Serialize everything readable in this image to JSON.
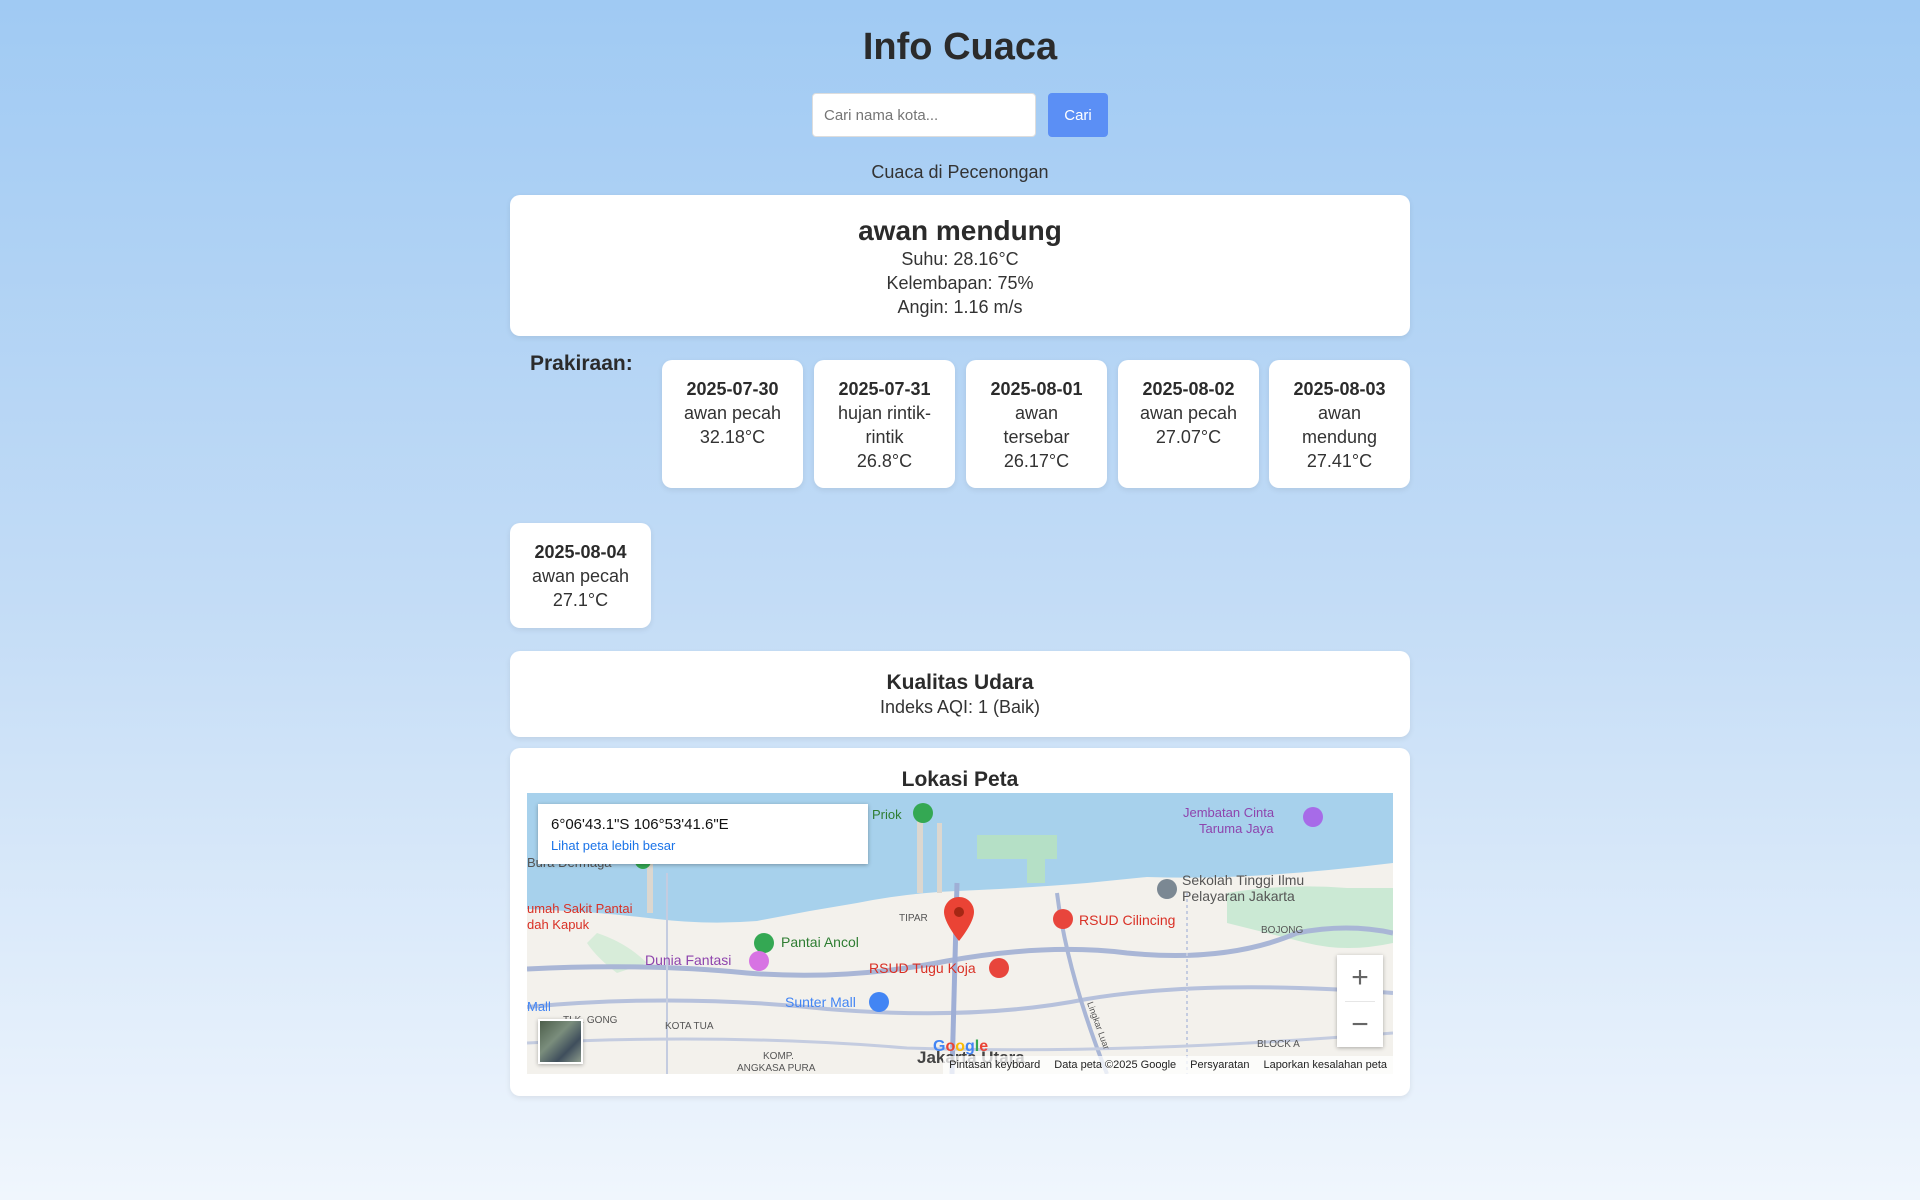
{
  "app": {
    "title": "Info Cuaca"
  },
  "search": {
    "placeholder": "Cari nama kota...",
    "value": "",
    "button_label": "Cari"
  },
  "location": {
    "label": "Cuaca di Pecenongan"
  },
  "current": {
    "description": "awan mendung",
    "temperature": "Suhu: 28.16°C",
    "humidity": "Kelembapan: 75%",
    "wind": "Angin: 1.16 m/s"
  },
  "forecast": {
    "label": "Prakiraan:",
    "days": [
      {
        "date": "2025-07-30",
        "desc": "awan pecah",
        "temp": "32.18°C"
      },
      {
        "date": "2025-07-31",
        "desc": "hujan rintik-rintik",
        "temp": "26.8°C"
      },
      {
        "date": "2025-08-01",
        "desc": "awan tersebar",
        "temp": "26.17°C"
      },
      {
        "date": "2025-08-02",
        "desc": "awan pecah",
        "temp": "27.07°C"
      },
      {
        "date": "2025-08-03",
        "desc": "awan mendung",
        "temp": "27.41°C"
      },
      {
        "date": "2025-08-04",
        "desc": "awan pecah",
        "temp": "27.1°C"
      }
    ]
  },
  "air_quality": {
    "title": "Kualitas Udara",
    "index": "Indeks AQI: 1 (Baik)"
  },
  "map": {
    "title": "Lokasi Peta",
    "coords": "6°06'43.1\"S 106°53'41.6\"E",
    "larger_map_link": "Lihat peta lebih besar",
    "zoom_in": "+",
    "zoom_out": "−",
    "google_logo": [
      "G",
      "o",
      "o",
      "g",
      "l",
      "e"
    ],
    "places": {
      "priok": "Priok",
      "jembatan": "Jembatan Cinta",
      "taruma": "Taruma Jaya",
      "bura": "Bura Dermaga",
      "sekolah1": "Sekolah Tinggi Ilmu",
      "sekolah2": "Pelayaran Jakarta",
      "rs_pantai1": "umah Sakit Pantai",
      "rs_pantai2": "dah Kapuk",
      "tipar": "TIPAR",
      "rsud_cilincing": "RSUD Cilincing",
      "bojong": "BOJONG",
      "pantai_ancol": "Pantai Ancol",
      "dunia_fantasi": "Dunia Fantasi",
      "rsud_tugu": "RSUD Tugu Koja",
      "mall": "Mall",
      "gong": "TLK. GONG",
      "kota_tua": "KOTA TUA",
      "sunter": "Sunter Mall",
      "komp1": "KOMP.",
      "komp2": "ANGKASA PURA",
      "jakarta_utara": "Jakarta Utara",
      "lingkar": "Lingkar Luar",
      "block_a": "BLOCK A"
    },
    "footer": {
      "shortcuts": "Pintasan keyboard",
      "data": "Data peta ©2025 Google",
      "terms": "Persyaratan",
      "report": "Laporkan kesalahan peta"
    }
  }
}
